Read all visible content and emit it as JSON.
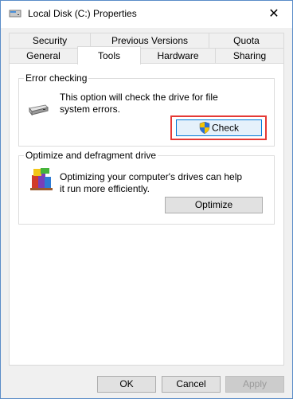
{
  "window": {
    "title": "Local Disk (C:) Properties",
    "close_label": "✕"
  },
  "tabs": {
    "row1": [
      "Security",
      "Previous Versions",
      "Quota"
    ],
    "row2": [
      "General",
      "Tools",
      "Hardware",
      "Sharing"
    ],
    "active": "Tools"
  },
  "error_checking": {
    "title": "Error checking",
    "description": "This option will check the drive for file system errors.",
    "button": "Check"
  },
  "optimize": {
    "title": "Optimize and defragment drive",
    "description": "Optimizing your computer's drives can help it run more efficiently.",
    "button": "Optimize"
  },
  "footer": {
    "ok": "OK",
    "cancel": "Cancel",
    "apply": "Apply"
  },
  "colors": {
    "highlight": "#e53935",
    "check_focus": "#0078d7"
  },
  "icons": [
    "drive-icon",
    "shield-icon",
    "defrag-icon",
    "close-icon"
  ]
}
